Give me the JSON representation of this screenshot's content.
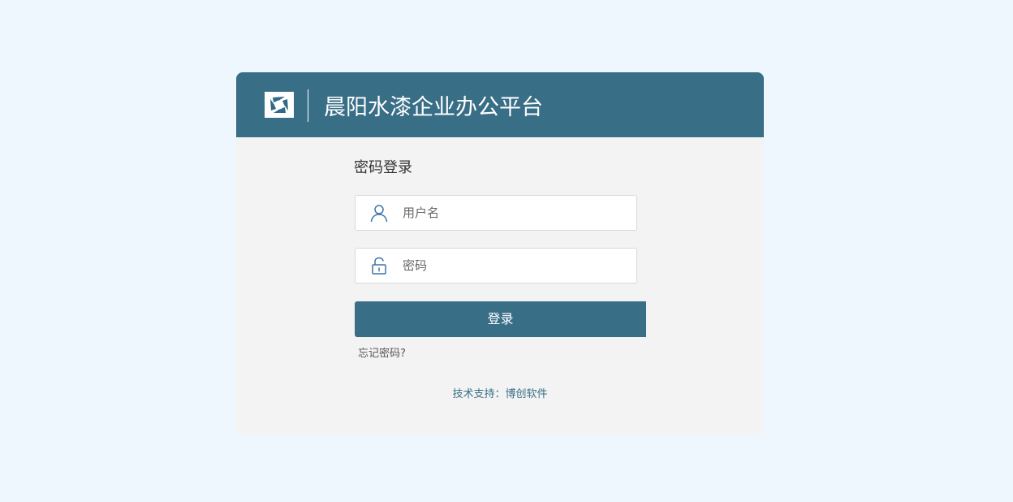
{
  "header": {
    "logo_icon": "company-logo",
    "title": "晨阳水漆企业办公平台"
  },
  "form": {
    "title": "密码登录",
    "username": {
      "icon": "user-icon",
      "placeholder": "用户名",
      "value": ""
    },
    "password": {
      "icon": "lock-icon",
      "placeholder": "密码",
      "value": ""
    },
    "login_label": "登录",
    "forgot_label": "忘记密码?"
  },
  "footer": {
    "support_text": "技术支持：博创软件"
  },
  "colors": {
    "page_background": "#eef6fe",
    "brand": "#396e87",
    "card_background": "#f3f3f3",
    "icon": "#3b73a8"
  }
}
